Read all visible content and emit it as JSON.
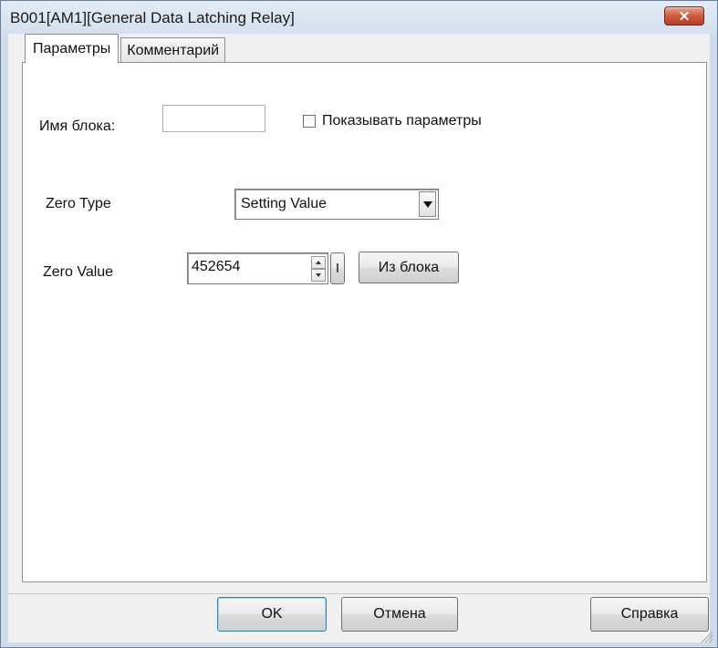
{
  "window": {
    "title": "B001[AM1][General Data Latching Relay]",
    "close_glyph": "✕"
  },
  "tabs": [
    {
      "label": "Параметры",
      "active": true
    },
    {
      "label": "Комментарий",
      "active": false
    }
  ],
  "params": {
    "block_name_label": "Имя блока:",
    "block_name_value": "",
    "show_params_label": "Показывать параметры",
    "show_params_checked": false,
    "zero_type_label": "Zero Type",
    "zero_type_value": "Setting Value",
    "zero_value_label": "Zero Value",
    "zero_value": "452654",
    "small_button_label": "I",
    "from_block_label": "Из блока"
  },
  "footer": {
    "ok_label": "OK",
    "cancel_label": "Отмена",
    "help_label": "Справка"
  },
  "icons": {
    "close": "close-icon",
    "dropdown": "chevron-down-icon",
    "spin_up": "spin-up-icon",
    "spin_down": "spin-down-icon",
    "resize": "resize-grip-icon"
  },
  "colors": {
    "close_button": "#cf5a3f",
    "title_bar": "#d3dfec",
    "dialog_bg": "#f0f0f0"
  }
}
